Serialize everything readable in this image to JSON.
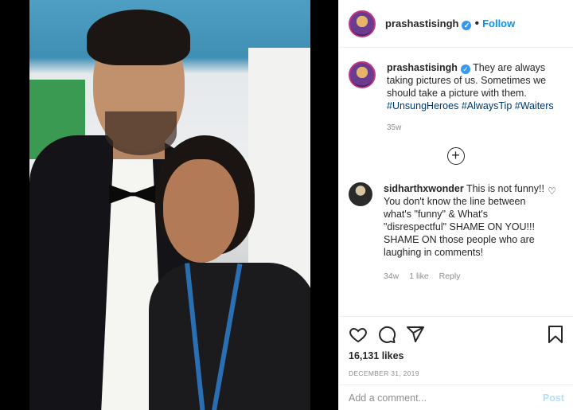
{
  "post": {
    "username": "prashastisingh",
    "follow_label": "Follow",
    "separator": "•",
    "verified_icon": "✓"
  },
  "caption": {
    "username": "prashastisingh",
    "text": "They are always taking pictures of us. Sometimes we should take a picture with them.",
    "hashtags": [
      "#UnsungHeroes",
      "#AlwaysTip",
      "#Waiters"
    ],
    "time": "35w"
  },
  "load_more_icon": "+",
  "comment": {
    "username": "sidharthxwonder",
    "text": "This is not funny!! You don't know the line between what's \"funny\" & What's \"disrespectful\" SHAME ON YOU!!! SHAME ON those people who are laughing in comments!",
    "time": "34w",
    "likes": "1 like",
    "reply": "Reply"
  },
  "stats": {
    "likes": "16,131 likes",
    "date": "DECEMBER 31, 2019"
  },
  "composer": {
    "placeholder": "Add a comment...",
    "post_label": "Post"
  },
  "colors": {
    "link_blue": "#0095f6",
    "hashtag": "#00376b",
    "muted": "#8e8e8e",
    "post_disabled": "#b2dffc"
  }
}
